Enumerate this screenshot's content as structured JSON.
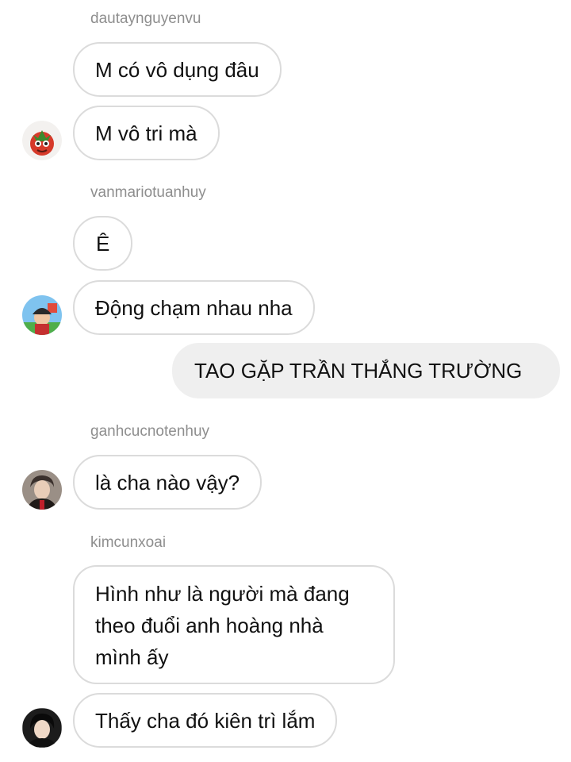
{
  "messages": [
    {
      "sender": "dautaynguyenvu"
    },
    {
      "text": "M có vô dụng đâu"
    },
    {
      "text": "M vô tri mà",
      "avatar": "tomato-avatar-icon"
    },
    {
      "sender": "vanmariotuanhuy"
    },
    {
      "text": "Ê"
    },
    {
      "text": "Động chạm nhau nha",
      "avatar": "mario-avatar-icon"
    },
    {
      "text": "TAO GẶP TRẦN THẮNG TRƯỜNG",
      "outgoing": true
    },
    {
      "sender": "ganhcucnotenhuy"
    },
    {
      "text": "là cha nào vậy?",
      "avatar": "person-avatar-icon"
    },
    {
      "sender": "kimcunxoai"
    },
    {
      "text": "Hình như là người mà đang theo đuổi anh hoàng nhà mình ấy"
    },
    {
      "text": "Thấy cha đó kiên trì lắm",
      "avatar": "person-avatar-icon"
    }
  ],
  "colors": {
    "bubble_border": "#dbdbdb",
    "outgoing_bubble": "#efefef",
    "sender_name": "#8e8e8e",
    "text": "#111111"
  }
}
